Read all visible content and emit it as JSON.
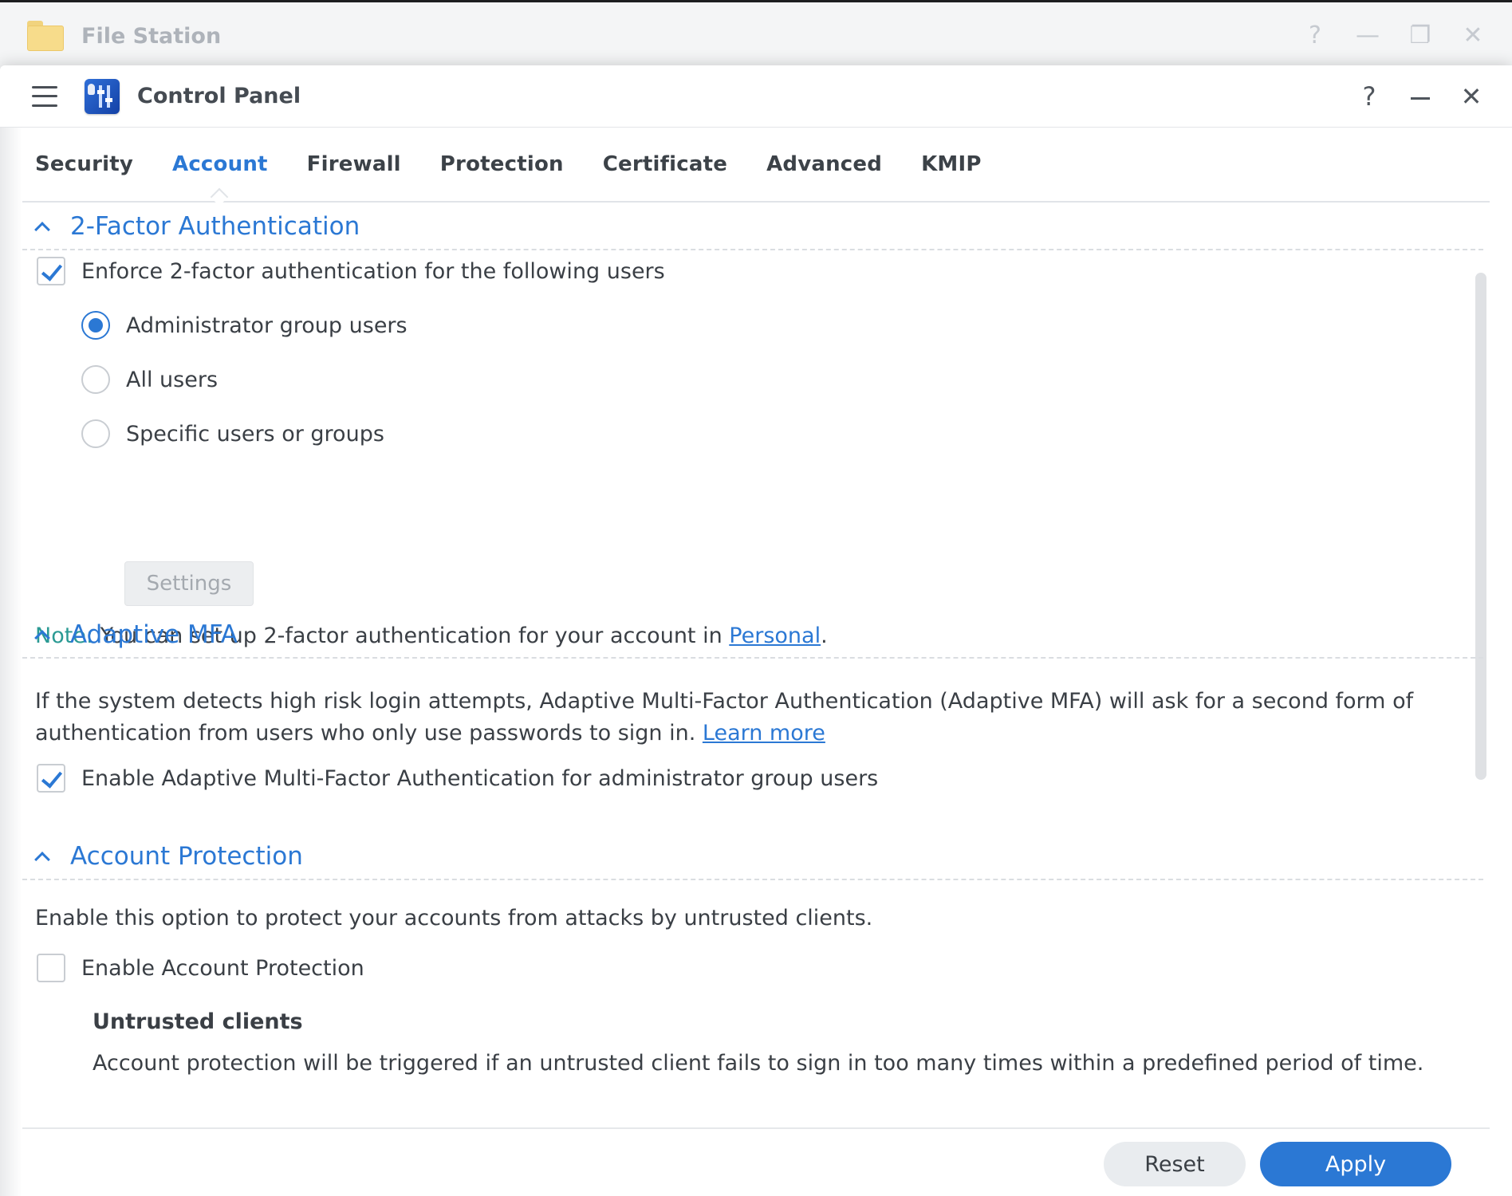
{
  "background_window": {
    "title": "File Station",
    "controls": [
      "?",
      "—",
      "❐",
      "✕"
    ]
  },
  "window": {
    "title": "Control Panel",
    "controls": [
      "?",
      "—",
      "✕"
    ]
  },
  "tabs": [
    {
      "label": "Security",
      "active": false
    },
    {
      "label": "Account",
      "active": true
    },
    {
      "label": "Firewall",
      "active": false
    },
    {
      "label": "Protection",
      "active": false
    },
    {
      "label": "Certificate",
      "active": false
    },
    {
      "label": "Advanced",
      "active": false
    },
    {
      "label": "KMIP",
      "active": false
    }
  ],
  "two_factor": {
    "title": "2-Factor Authentication",
    "enforce_label": "Enforce 2-factor authentication for the following users",
    "enforce_checked": true,
    "options": [
      {
        "label": "Administrator group users",
        "selected": true
      },
      {
        "label": "All users",
        "selected": false
      },
      {
        "label": "Specific users or groups",
        "selected": false
      }
    ],
    "settings_button": "Settings",
    "note_label": "Note:",
    "note_text": " You can set up 2-factor authentication for your account in ",
    "note_link": "Personal",
    "note_end": "."
  },
  "adaptive_mfa": {
    "title": "Adaptive MFA",
    "description_line1": "If the system detects high risk login attempts, Adaptive Multi-Factor Authentication (Adaptive MFA) will ask for a second form of",
    "description_line2": "authentication from users who only use passwords to sign in. ",
    "learn_more": "Learn more",
    "enable_label": "Enable Adaptive Multi-Factor Authentication for administrator group users",
    "enable_checked": true
  },
  "account_protection": {
    "title": "Account Protection",
    "description": "Enable this option to protect your accounts from attacks by untrusted clients.",
    "enable_label": "Enable Account Protection",
    "enable_checked": false,
    "untrusted_title": "Untrusted clients",
    "untrusted_text": "Account protection will be triggered if an untrusted client fails to sign in too many times within a predefined period of time."
  },
  "footer": {
    "reset": "Reset",
    "apply": "Apply"
  },
  "colors": {
    "accent": "#2b78d4",
    "note": "#2b9a94"
  }
}
